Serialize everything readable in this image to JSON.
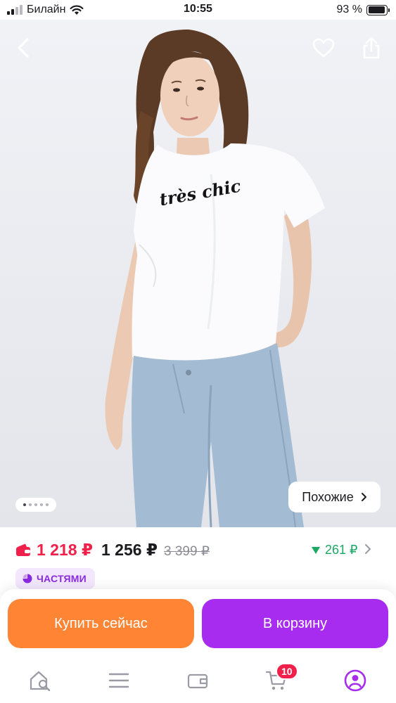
{
  "status_bar": {
    "carrier": "Билайн",
    "time": "10:55",
    "battery": "93 %",
    "battery_level": 0.93
  },
  "product_image": {
    "print_text": "très chic",
    "total_images": 5,
    "active_image": 1,
    "similar_label": "Похожие"
  },
  "icons": {
    "back": "chevron-left-icon",
    "favorite": "heart-icon",
    "share": "share-icon",
    "wallet": "wallet-icon",
    "price_drop": "triangle-down-icon",
    "installments": "pie-chart-icon"
  },
  "price": {
    "wallet_price": "1 218 ₽",
    "regular_price": "1 256 ₽",
    "old_price": "3 399 ₽",
    "price_drop": "261 ₽"
  },
  "installments": {
    "label": "ЧАСТЯМИ"
  },
  "actions": {
    "buy_now": "Купить сейчас",
    "add_to_cart": "В корзину"
  },
  "tab_bar": {
    "items": [
      {
        "name": "home-search-icon"
      },
      {
        "name": "catalog-icon"
      },
      {
        "name": "wallet-icon"
      },
      {
        "name": "cart-icon",
        "badge": "10"
      },
      {
        "name": "profile-icon"
      }
    ]
  },
  "colors": {
    "wallet_price": "#f1204b",
    "price_drop": "#1aa865",
    "buy_now": "#ff8534",
    "add_to_cart": "#a72cf0",
    "installments": "#8a2be2"
  }
}
